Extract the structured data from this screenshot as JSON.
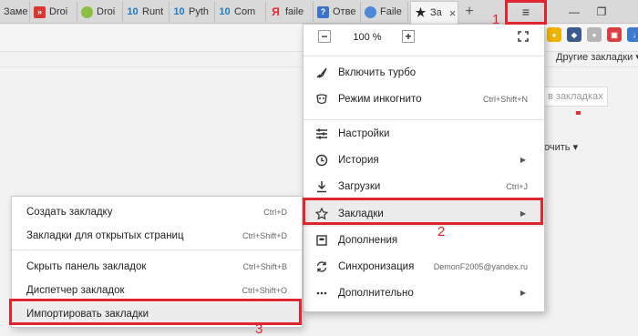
{
  "tabs": [
    {
      "label": "Заме",
      "icon": "",
      "icon_color": ""
    },
    {
      "label": "Droi",
      "icon": "»",
      "icon_color": "#d9382f"
    },
    {
      "label": "Droi",
      "icon": "●",
      "icon_color": "#8bbf44"
    },
    {
      "label": "Runt",
      "icon": "10",
      "icon_color": "#1e7cc8"
    },
    {
      "label": "Pyth",
      "icon": "10",
      "icon_color": "#1e7cc8"
    },
    {
      "label": "Com",
      "icon": "10",
      "icon_color": "#1e7cc8"
    },
    {
      "label": "failе",
      "icon": "Я",
      "icon_color": "#e0262d"
    },
    {
      "label": "Отве",
      "icon": "?",
      "icon_color": "#3b73c9"
    },
    {
      "label": "Faile",
      "icon": "●",
      "icon_color": "#4a8ad6"
    },
    {
      "label": "За",
      "icon": "★",
      "icon_color": "#222222",
      "active": true
    }
  ],
  "toolbar": {
    "new_tab": "+",
    "menu_icon": "≡",
    "minimize": "—",
    "restore": "❐"
  },
  "page": {
    "other_bookmarks": "Другие закладки ▾",
    "search_placeholder": "в закладках",
    "sort_label": "очить ▾"
  },
  "menu": {
    "zoom_minus": "−",
    "zoom_value": "100 %",
    "zoom_plus": "+",
    "items": [
      {
        "label": "Включить турбо",
        "icon": "rocket-icon",
        "shortcut": ""
      },
      {
        "label": "Режим инкогнито",
        "icon": "incognito-icon",
        "shortcut": "Ctrl+Shift+N"
      },
      {
        "label": "Настройки",
        "icon": "sliders-icon",
        "shortcut": ""
      },
      {
        "label": "История",
        "icon": "clock-icon",
        "shortcut": "",
        "arrow": "▶"
      },
      {
        "label": "Загрузки",
        "icon": "download-icon",
        "shortcut": "Ctrl+J"
      },
      {
        "label": "Закладки",
        "icon": "star-icon",
        "shortcut": "",
        "arrow": "▶"
      },
      {
        "label": "Дополнения",
        "icon": "addons-icon",
        "shortcut": ""
      },
      {
        "label": "Синхронизация",
        "icon": "sync-icon",
        "shortcut": "DemonF2005@yandex.ru"
      },
      {
        "label": "Дополнительно",
        "icon": "more-icon",
        "shortcut": "",
        "arrow": "▶"
      }
    ]
  },
  "submenu": {
    "items": [
      {
        "label": "Создать закладку",
        "shortcut": "Ctrl+D"
      },
      {
        "label": "Закладки для открытых страниц",
        "shortcut": "Ctrl+Shift+D"
      },
      {
        "label": "Скрыть панель закладок",
        "shortcut": "Ctrl+Shift+B"
      },
      {
        "label": "Диспетчер закладок",
        "shortcut": "Ctrl+Shift+O"
      },
      {
        "label": "Импортировать закладки",
        "shortcut": ""
      }
    ]
  },
  "annotations": {
    "step1": "1",
    "step2": "2",
    "step3": "3",
    "color": "#e0262d"
  }
}
